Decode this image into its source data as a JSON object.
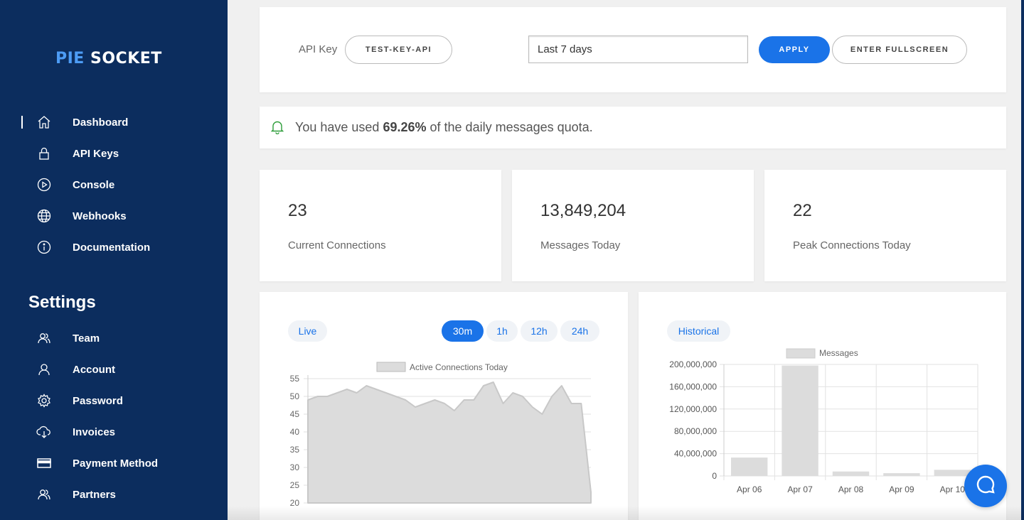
{
  "brand": {
    "pie": "PIE",
    "socket": " SOCKET"
  },
  "sidebar": {
    "nav": [
      {
        "label": "Dashboard",
        "icon": "home-icon"
      },
      {
        "label": "API Keys",
        "icon": "lock-icon"
      },
      {
        "label": "Console",
        "icon": "play-circle-icon"
      },
      {
        "label": "Webhooks",
        "icon": "globe-icon"
      },
      {
        "label": "Documentation",
        "icon": "info-icon"
      }
    ],
    "settings_title": "Settings",
    "settings": [
      {
        "label": "Team",
        "icon": "users-icon"
      },
      {
        "label": "Account",
        "icon": "user-icon"
      },
      {
        "label": "Password",
        "icon": "gear-icon"
      },
      {
        "label": "Invoices",
        "icon": "cloud-download-icon"
      },
      {
        "label": "Payment Method",
        "icon": "credit-card-icon"
      },
      {
        "label": "Partners",
        "icon": "users-icon"
      }
    ]
  },
  "toolbar": {
    "api_key_label": "API Key",
    "api_key_value": "TEST-KEY-API",
    "date_range_value": "Last 7 days",
    "apply_label": "APPLY",
    "fullscreen_label": "ENTER FULLSCREEN"
  },
  "alert": {
    "prefix": "You have used ",
    "percent": "69.26%",
    "suffix": " of the daily messages quota."
  },
  "stats": [
    {
      "value": "23",
      "label": "Current Connections"
    },
    {
      "value": "13,849,204",
      "label": "Messages Today"
    },
    {
      "value": "22",
      "label": "Peak Connections Today"
    }
  ],
  "live_panel": {
    "tag": "Live",
    "ranges": [
      "30m",
      "1h",
      "12h",
      "24h"
    ],
    "selected_range": "30m"
  },
  "historical_panel": {
    "tag": "Historical"
  },
  "colors": {
    "sidebar": "#0c2d5e",
    "accent": "#1a73e8",
    "logo_accent": "#4d9cf5",
    "series_fill": "#dcdcdc"
  },
  "chart_data": [
    {
      "type": "area",
      "legend": "Active Connections Today",
      "ylim": [
        20,
        55
      ],
      "yticks": [
        "55",
        "50",
        "45",
        "40",
        "35",
        "30",
        "25",
        "20"
      ],
      "series": [
        {
          "name": "Active Connections Today",
          "values": [
            49,
            50,
            50,
            51,
            52,
            51,
            53,
            52,
            51,
            50,
            49,
            47,
            48,
            49,
            48,
            46,
            49,
            49,
            53,
            54,
            48,
            51,
            50,
            47,
            45,
            50,
            53,
            48,
            48,
            23
          ]
        }
      ]
    },
    {
      "type": "bar",
      "legend": "Messages",
      "categories": [
        "Apr 06",
        "Apr 07",
        "Apr 08",
        "Apr 09",
        "Apr 10"
      ],
      "values": [
        33000000,
        198000000,
        8000000,
        5000000,
        11000000
      ],
      "ylim": [
        0,
        200000000
      ],
      "yticks": [
        "200,000,000",
        "160,000,000",
        "120,000,000",
        "80,000,000",
        "40,000,000",
        "0"
      ],
      "series": [
        {
          "name": "Messages",
          "values": [
            33000000,
            198000000,
            8000000,
            5000000,
            11000000
          ]
        }
      ]
    }
  ]
}
